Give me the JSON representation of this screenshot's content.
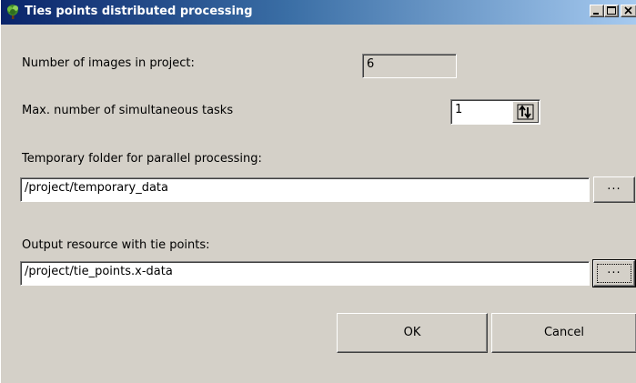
{
  "window": {
    "title": "Ties points distributed processing",
    "icon": "tree-app-icon",
    "controls": [
      "minimize-icon",
      "maximize-icon",
      "close-icon"
    ]
  },
  "images_count": {
    "label": "Number of images in project:",
    "value": "6"
  },
  "max_tasks": {
    "label": "Max. number of simultaneous tasks",
    "value": "1",
    "spinner_icon": "spin-arrows-icon"
  },
  "temp_folder": {
    "label": "Temporary folder for parallel processing:",
    "value": "/project/temporary_data",
    "browse_label": "..."
  },
  "output_resource": {
    "label": "Output resource with tie points:",
    "value": "/project/tie_points.x-data",
    "browse_label": "..."
  },
  "footer": {
    "ok_label": "OK",
    "cancel_label": "Cancel"
  },
  "colors": {
    "title_gradient_start": "#0a246a",
    "title_gradient_end": "#a6caf0",
    "dialog_face": "#d4d0c8"
  }
}
